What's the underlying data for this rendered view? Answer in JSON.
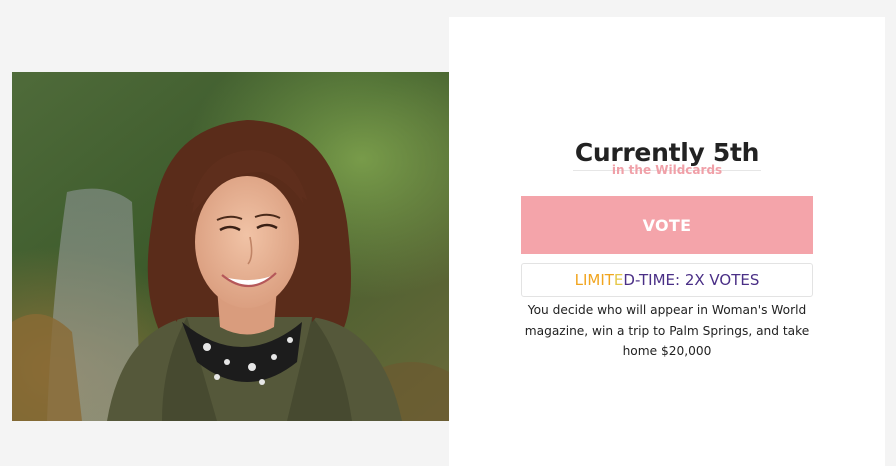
{
  "photo": {
    "alt": "Portrait of a smiling woman with shoulder-length brown hair, wearing an olive jacket and a black and white scarf, outdoors"
  },
  "ranking": {
    "title": "Currently 5th",
    "subtitle": "in the Wildcards"
  },
  "vote": {
    "label": "VOTE",
    "button_color": "#f4a4aa"
  },
  "promo": {
    "part1": "LIMIT",
    "part2": "E",
    "part3": "D-TIME: 2X VOTES"
  },
  "description": "You decide who will appear in Woman's World magazine, win a trip to Palm Springs, and take home $20,000",
  "colors": {
    "accent_pink": "#f0a0a8",
    "promo_orange": "#f1a51f",
    "promo_purple": "#4a2f86"
  }
}
